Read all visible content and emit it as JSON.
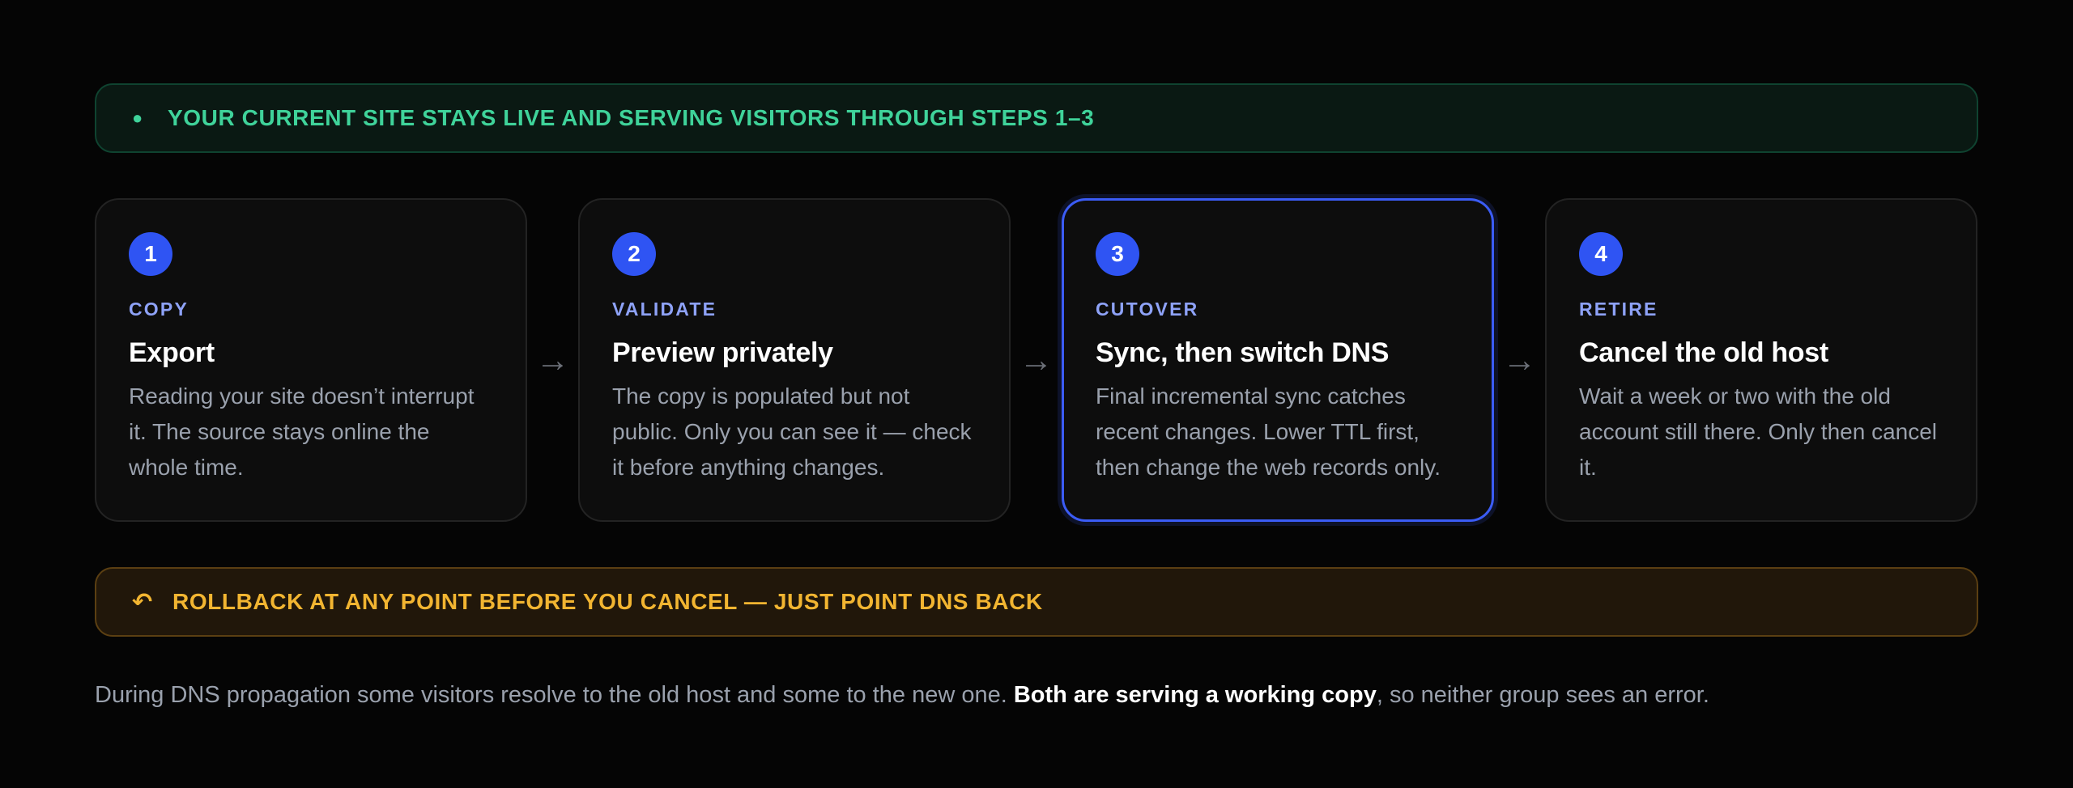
{
  "banner_live": {
    "icon": "dot-icon",
    "glyph": "●",
    "text": "YOUR CURRENT SITE STAYS LIVE AND SERVING VISITORS THROUGH STEPS 1–3",
    "color": "#3fd39a"
  },
  "steps": [
    {
      "number": "1",
      "phase": "COPY",
      "title": "Export",
      "description": "Reading your site doesn’t interrupt it. The source stays online the whole time.",
      "active": false
    },
    {
      "number": "2",
      "phase": "VALIDATE",
      "title": "Preview privately",
      "description": "The copy is populated but not public. Only you can see it — check it before anything changes.",
      "active": false
    },
    {
      "number": "3",
      "phase": "CUTOVER",
      "title": "Sync, then switch DNS",
      "description": "Final incremental sync catches recent changes. Lower TTL first, then change the web records only.",
      "active": true
    },
    {
      "number": "4",
      "phase": "RETIRE",
      "title": "Cancel the old host",
      "description": "Wait a week or two with the old account still there. Only then cancel it.",
      "active": false
    }
  ],
  "arrow_glyph": "→",
  "banner_rollback": {
    "icon": "undo-arrow-icon",
    "glyph": "↶",
    "text": "ROLLBACK AT ANY POINT BEFORE YOU CANCEL — JUST POINT DNS BACK",
    "color": "#f2b531"
  },
  "footnote": {
    "before": "During DNS propagation some visitors resolve to the old host and some to the new one. ",
    "emphasis": "Both are serving a working copy",
    "after": ", so neither group sees an error."
  },
  "colors": {
    "background": "#050505",
    "accent": "#2f54f3",
    "phase_label": "#8ea2f7",
    "muted_text": "#9aa1ad"
  }
}
